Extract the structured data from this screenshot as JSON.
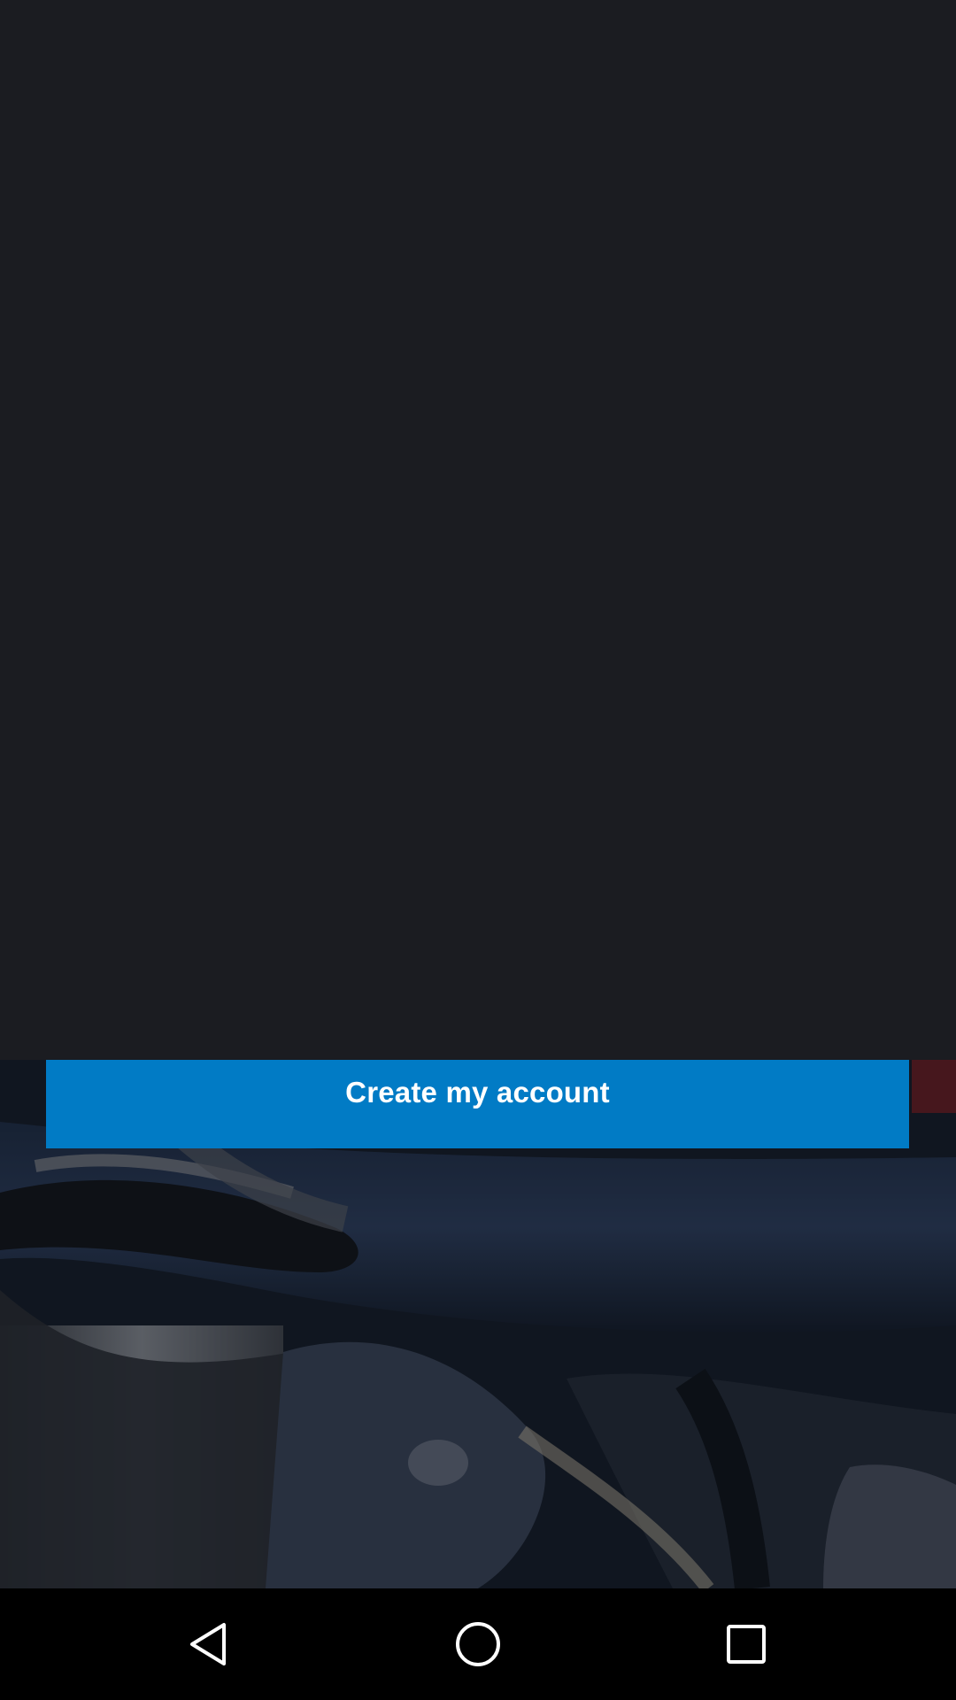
{
  "signup": {
    "create_account_label": "Create my account"
  },
  "colors": {
    "background": "#1b1c21",
    "primary_button": "#017bc5",
    "button_text": "#ffffff",
    "nav_bar": "#000000"
  },
  "nav_bar": {
    "icons": [
      "back-icon",
      "home-icon",
      "recents-icon"
    ]
  }
}
